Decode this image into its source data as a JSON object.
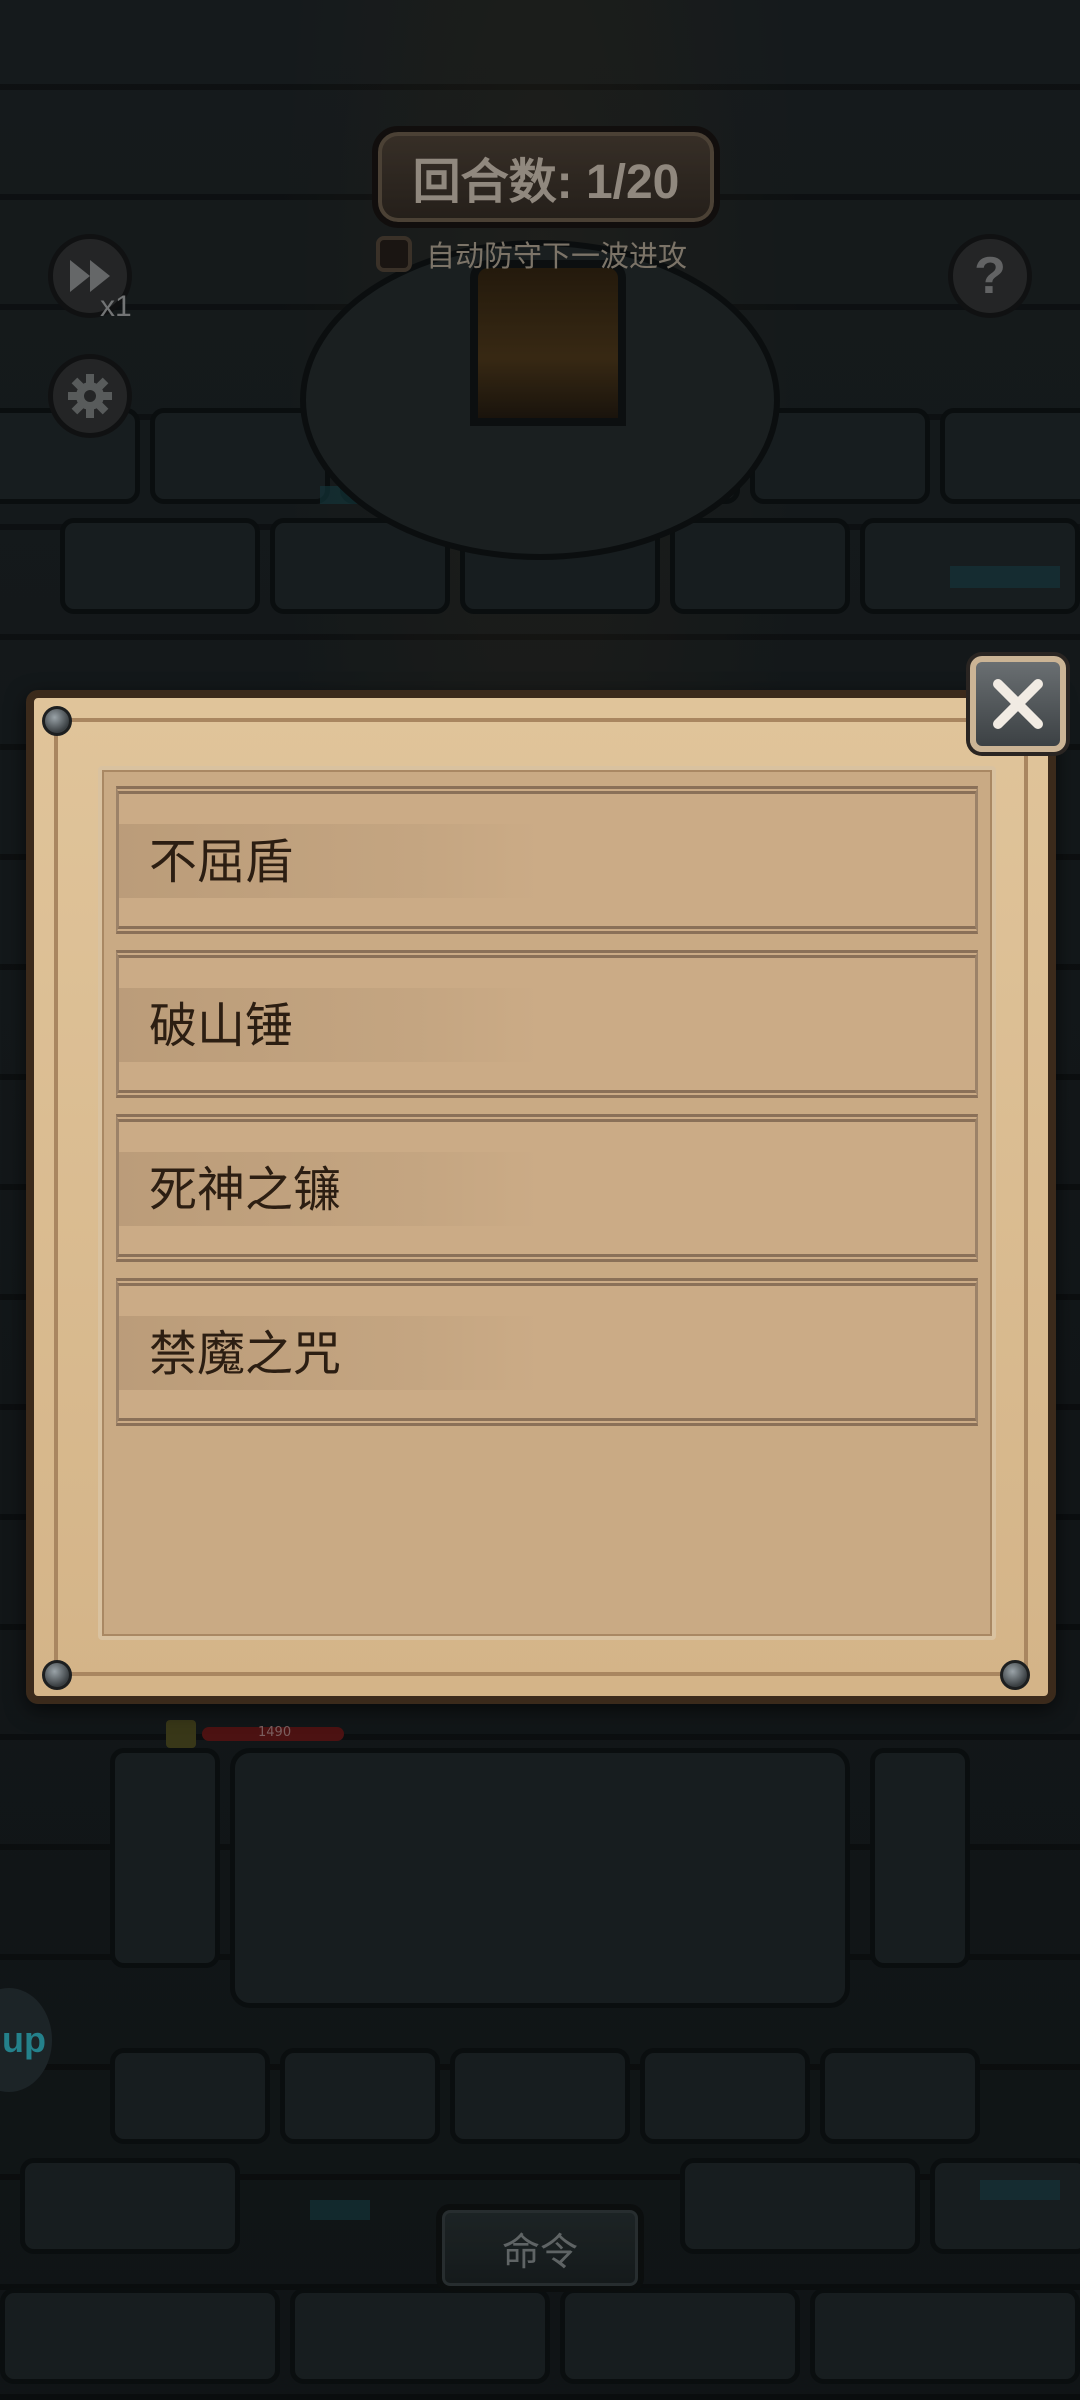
{
  "hud": {
    "round_label": "回合数: 1/20",
    "auto_defend_label": "自动防守下一波进攻",
    "auto_defend_checked": false,
    "speed_label": "x1",
    "help_icon": "question-icon",
    "settings_icon": "gear-icon",
    "speed_icon": "fast-forward-icon",
    "side_tab_label": "up"
  },
  "unit": {
    "hp_value": "1490"
  },
  "dialog": {
    "close_icon": "close-icon",
    "items": [
      {
        "label": "不屈盾"
      },
      {
        "label": "破山锤"
      },
      {
        "label": "死神之镰"
      },
      {
        "label": "禁魔之咒"
      }
    ]
  },
  "command": {
    "label": "命令"
  },
  "colors": {
    "parchment": "#d4b488",
    "item_text": "#2c1e12",
    "background": "#1b2326"
  }
}
